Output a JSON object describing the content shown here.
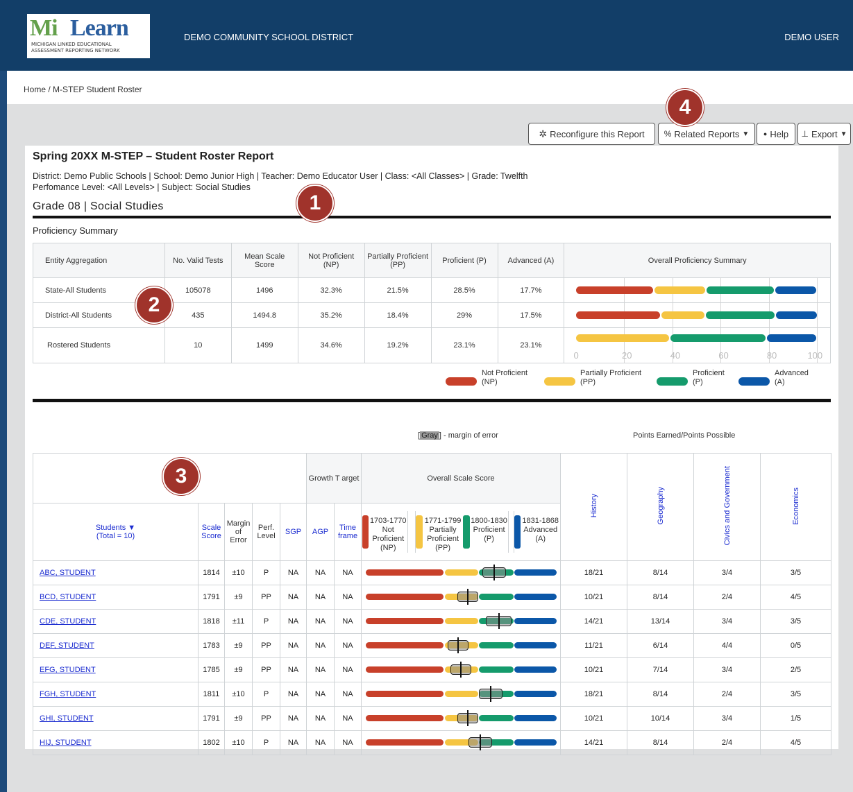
{
  "header": {
    "logo_text_mi": "Mi",
    "logo_text_learn": "Learn",
    "logo_sub1": "MICHIGAN LINKED EDUCATIONAL",
    "logo_sub2": "ASSESSMENT REPORTING NETWORK",
    "district": "DEMO COMMUNITY SCHOOL DISTRICT",
    "user": "DEMO USER"
  },
  "breadcrumb": {
    "home": "Home",
    "sep": " / ",
    "current": "M-STEP Student Roster"
  },
  "toolbar": {
    "reconfigure": "Reconfigure this Report",
    "related": "Related Reports",
    "help": "Help",
    "export": "Export"
  },
  "badges": {
    "b1": "1",
    "b2": "2",
    "b3": "3",
    "b4": "4"
  },
  "report": {
    "title": "Spring 20XX M-STEP – Student Roster Report",
    "filters_line1": "District: Demo Public Schools | School: Demo Junior High | Teacher: Demo Educator User | Class: <All Classes> | Grade: Twelfth",
    "filters_line2": "Perfomance Level: <All Levels> | Subject: Social Studies",
    "grade_title": "Grade 08 | Social Studies",
    "proficiency_title": "Proficiency Summary"
  },
  "summary": {
    "headers": [
      "Entity Aggregation",
      "No. Valid Tests",
      "Mean Scale Score",
      "Not Proficient (NP)",
      "Partially Proficient (PP)",
      "Proficient (P)",
      "Advanced (A)",
      "Overall Proficiency Summary"
    ],
    "rows": [
      {
        "entity": "State-All Students",
        "tests": "105078",
        "mean": "1496",
        "np": "32.3%",
        "pp": "21.5%",
        "p": "28.5%",
        "a": "17.7%"
      },
      {
        "entity": "District-All Students",
        "tests": "435",
        "mean": "1494.8",
        "np": "35.2%",
        "pp": "18.4%",
        "p": "29%",
        "a": "17.5%"
      },
      {
        "entity": "Rostered Students",
        "tests": "10",
        "mean": "1499",
        "np": "34.6%",
        "pp": "19.2%",
        "p": "23.1%",
        "a": "23.1%"
      }
    ],
    "axis": [
      "0",
      "20",
      "40",
      "60",
      "80",
      "100"
    ]
  },
  "chart_data": {
    "type": "bar",
    "title": "Overall Proficiency Summary",
    "categories": [
      "State-All Students",
      "District-All Students",
      "Rostered Students"
    ],
    "series": [
      {
        "name": "Not Proficient (NP)",
        "values": [
          32.3,
          35.2,
          0
        ]
      },
      {
        "name": "Partially Proficient (PP)",
        "values": [
          21.5,
          18.4,
          39
        ]
      },
      {
        "name": "Proficient (P)",
        "values": [
          28.5,
          29,
          40
        ]
      },
      {
        "name": "Advanced (A)",
        "values": [
          17.7,
          17.5,
          21
        ]
      }
    ],
    "xlim": [
      0,
      100
    ],
    "colors": [
      "#c8402a",
      "#f5c542",
      "#159b6c",
      "#0b57a8"
    ]
  },
  "legend": [
    {
      "l1": "Not Proficient",
      "l2": "(NP)",
      "color": "#c8402a"
    },
    {
      "l1": "Partially Proficient",
      "l2": "(PP)",
      "color": "#f5c542"
    },
    {
      "l1": "Proficient",
      "l2": "(P)",
      "color": "#159b6c"
    },
    {
      "l1": "Advanced",
      "l2": "(A)",
      "color": "#0b57a8"
    }
  ],
  "notes": {
    "gray_word": "Gray",
    "gray_rest": " - margin of error",
    "points": "Points Earned/Points Possible"
  },
  "roster": {
    "growth_target": "Growth T arget",
    "overall_scale": "Overall Scale Score",
    "students_label": "Students ▼",
    "students_total": "(Total = 10)",
    "col_scale": "Scale Score",
    "col_margin": "Margin of Error",
    "col_perf": "Perf. Level",
    "col_sgp": "SGP",
    "col_agp": "AGP",
    "col_time": "Time frame",
    "bands": [
      {
        "range": "1703-1770",
        "name": "Not Proficient",
        "abbr": "(NP)",
        "color": "#c8402a"
      },
      {
        "range": "1771-1799",
        "name": "Partially Proficient",
        "abbr": "(PP)",
        "color": "#f5c542"
      },
      {
        "range": "1800-1830",
        "name": "Proficient",
        "abbr": "(P)",
        "color": "#159b6c"
      },
      {
        "range": "1831-1868",
        "name": "Advanced",
        "abbr": "(A)",
        "color": "#0b57a8"
      }
    ],
    "subjects": [
      "History",
      "Geography",
      "Civics and Government",
      "Economics"
    ],
    "rows": [
      {
        "name": "ABC, STUDENT ",
        "score": "1814",
        "moe": "±10",
        "perf": "P",
        "sgp": "NA",
        "agp": "NA",
        "tf": "NA",
        "hist": "18/21",
        "geo": "8/14",
        "civ": "3/4",
        "eco": "3/5",
        "s": 1814,
        "m": 10
      },
      {
        "name": "BCD, STUDENT",
        "score": "1791",
        "moe": "±9",
        "perf": "PP",
        "sgp": "NA",
        "agp": "NA",
        "tf": "NA",
        "hist": "10/21",
        "geo": "8/14",
        "civ": "2/4",
        "eco": "4/5",
        "s": 1791,
        "m": 9
      },
      {
        "name": "CDE, STUDENT",
        "score": "1818",
        "moe": "±11",
        "perf": "P",
        "sgp": "NA",
        "agp": "NA",
        "tf": "NA",
        "hist": "14/21",
        "geo": "13/14",
        "civ": "3/4",
        "eco": "3/5",
        "s": 1818,
        "m": 11
      },
      {
        "name": "DEF, STUDENT",
        "score": "1783",
        "moe": "±9",
        "perf": "PP",
        "sgp": "NA",
        "agp": "NA",
        "tf": "NA",
        "hist": "11/21",
        "geo": "6/14",
        "civ": "4/4",
        "eco": "0/5",
        "s": 1783,
        "m": 9
      },
      {
        "name": "EFG, STUDENT",
        "score": "1785",
        "moe": "±9",
        "perf": "PP",
        "sgp": "NA",
        "agp": "NA",
        "tf": "NA",
        "hist": "10/21",
        "geo": "7/14",
        "civ": "3/4",
        "eco": "2/5",
        "s": 1785,
        "m": 9
      },
      {
        "name": "FGH, STUDENT",
        "score": "1811",
        "moe": "±10",
        "perf": "P",
        "sgp": "NA",
        "agp": "NA",
        "tf": "NA",
        "hist": "18/21",
        "geo": "8/14",
        "civ": "2/4",
        "eco": "3/5",
        "s": 1811,
        "m": 10
      },
      {
        "name": "GHI, STUDENT",
        "score": "1791",
        "moe": "±9",
        "perf": "PP",
        "sgp": "NA",
        "agp": "NA",
        "tf": "NA",
        "hist": "10/21",
        "geo": "10/14",
        "civ": "3/4",
        "eco": "1/5",
        "s": 1791,
        "m": 9
      },
      {
        "name": "HIJ, STUDENT",
        "score": "1802",
        "moe": "±10",
        "perf": "P",
        "sgp": "NA",
        "agp": "NA",
        "tf": "NA",
        "hist": "14/21",
        "geo": "8/14",
        "civ": "2/4",
        "eco": "4/5",
        "s": 1802,
        "m": 10
      }
    ]
  }
}
